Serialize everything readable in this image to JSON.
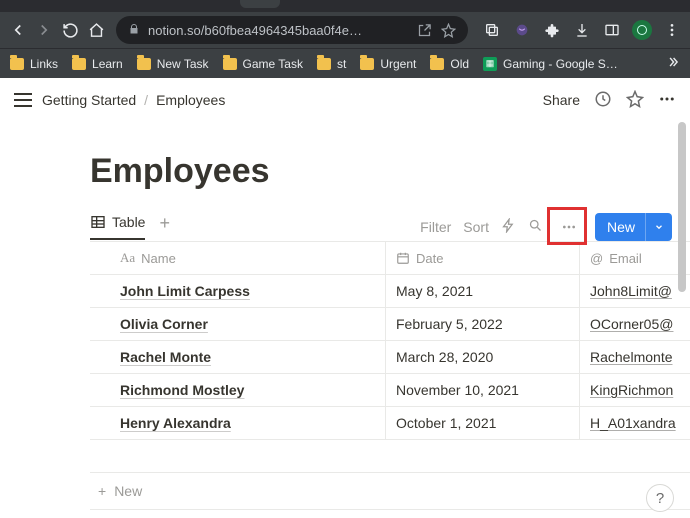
{
  "browser": {
    "url": "notion.so/b60fbea4964345baa0f4e…",
    "bookmarks": [
      {
        "label": "Links",
        "type": "folder"
      },
      {
        "label": "Learn",
        "type": "folder"
      },
      {
        "label": "New Task",
        "type": "folder"
      },
      {
        "label": "Game Task",
        "type": "folder"
      },
      {
        "label": "st",
        "type": "folder"
      },
      {
        "label": "Urgent",
        "type": "folder"
      },
      {
        "label": "Old",
        "type": "folder"
      },
      {
        "label": "Gaming - Google S…",
        "type": "sheet"
      }
    ]
  },
  "notion": {
    "breadcrumb": {
      "root": "Getting Started",
      "current": "Employees"
    },
    "share_label": "Share",
    "page_title": "Employees",
    "view": {
      "name": "Table"
    },
    "toolbar": {
      "filter": "Filter",
      "sort": "Sort",
      "new": "New"
    },
    "columns": {
      "name": "Name",
      "date": "Date",
      "email": "Email"
    },
    "rows": [
      {
        "name": "John Limit Carpess",
        "date": "May 8, 2021",
        "email": "John8Limit@"
      },
      {
        "name": "Olivia Corner",
        "date": "February 5, 2022",
        "email": "OCorner05@"
      },
      {
        "name": "Rachel Monte",
        "date": "March 28, 2020",
        "email": "Rachelmonte"
      },
      {
        "name": "Richmond Mostley",
        "date": "November 10, 2021",
        "email": "KingRichmon"
      },
      {
        "name": "Henry Alexandra",
        "date": "October 1, 2021",
        "email": "H_A01xandra"
      }
    ],
    "new_row_label": "New",
    "help_label": "?"
  }
}
